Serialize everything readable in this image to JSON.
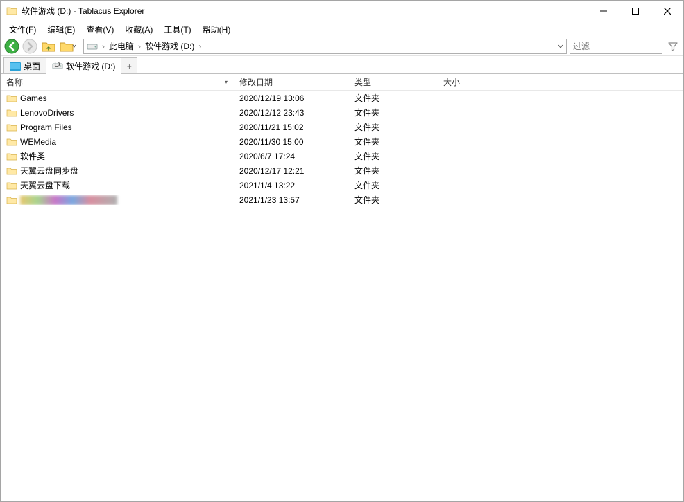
{
  "window": {
    "title": "软件游戏 (D:) - Tablacus Explorer"
  },
  "menus": {
    "file": "文件(F)",
    "edit": "编辑(E)",
    "view": "查看(V)",
    "fav": "收藏(A)",
    "tools": "工具(T)",
    "help": "帮助(H)"
  },
  "address": {
    "root": "此电脑",
    "current": "软件游戏 (D:)"
  },
  "filter": {
    "placeholder": "过滤"
  },
  "tabs": {
    "desktop": "桌面",
    "drive": "软件游戏 (D:)",
    "add": "+"
  },
  "columns": {
    "name": "名称",
    "date": "修改日期",
    "type": "类型",
    "size": "大小"
  },
  "rows": [
    {
      "name": "Games",
      "date": "2020/12/19 13:06",
      "type": "文件夹",
      "size": ""
    },
    {
      "name": "LenovoDrivers",
      "date": "2020/12/12 23:43",
      "type": "文件夹",
      "size": ""
    },
    {
      "name": "Program Files",
      "date": "2020/11/21 15:02",
      "type": "文件夹",
      "size": ""
    },
    {
      "name": "WEMedia",
      "date": "2020/11/30 15:00",
      "type": "文件夹",
      "size": ""
    },
    {
      "name": "软件类",
      "date": "2020/6/7 17:24",
      "type": "文件夹",
      "size": ""
    },
    {
      "name": "天翼云盘同步盘",
      "date": "2020/12/17 12:21",
      "type": "文件夹",
      "size": ""
    },
    {
      "name": "天翼云盘下载",
      "date": "2021/1/4 13:22",
      "type": "文件夹",
      "size": ""
    },
    {
      "name": "",
      "date": "2021/1/23 13:57",
      "type": "文件夹",
      "size": "",
      "blurred": true
    }
  ]
}
